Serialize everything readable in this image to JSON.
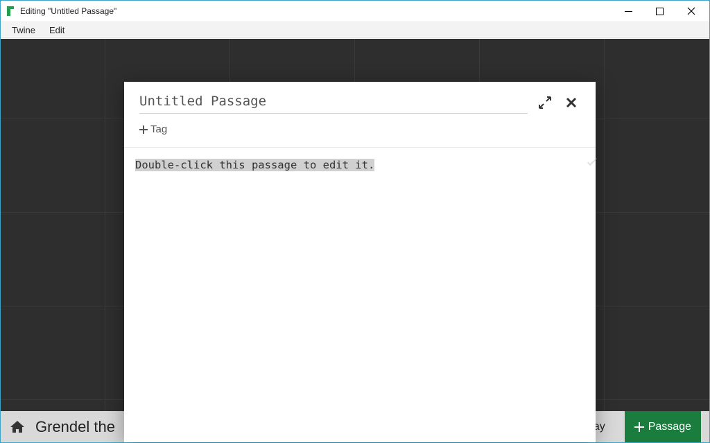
{
  "window": {
    "title": "Editing \"Untitled Passage\""
  },
  "menu": {
    "twine": "Twine",
    "edit": "Edit"
  },
  "bottom": {
    "story_title": "Grendel the",
    "play_label": "Play",
    "add_passage_label": "Passage"
  },
  "modal": {
    "passage_title": "Untitled Passage",
    "tag_label": "Tag",
    "body_text": "Double-click this passage to edit it."
  }
}
